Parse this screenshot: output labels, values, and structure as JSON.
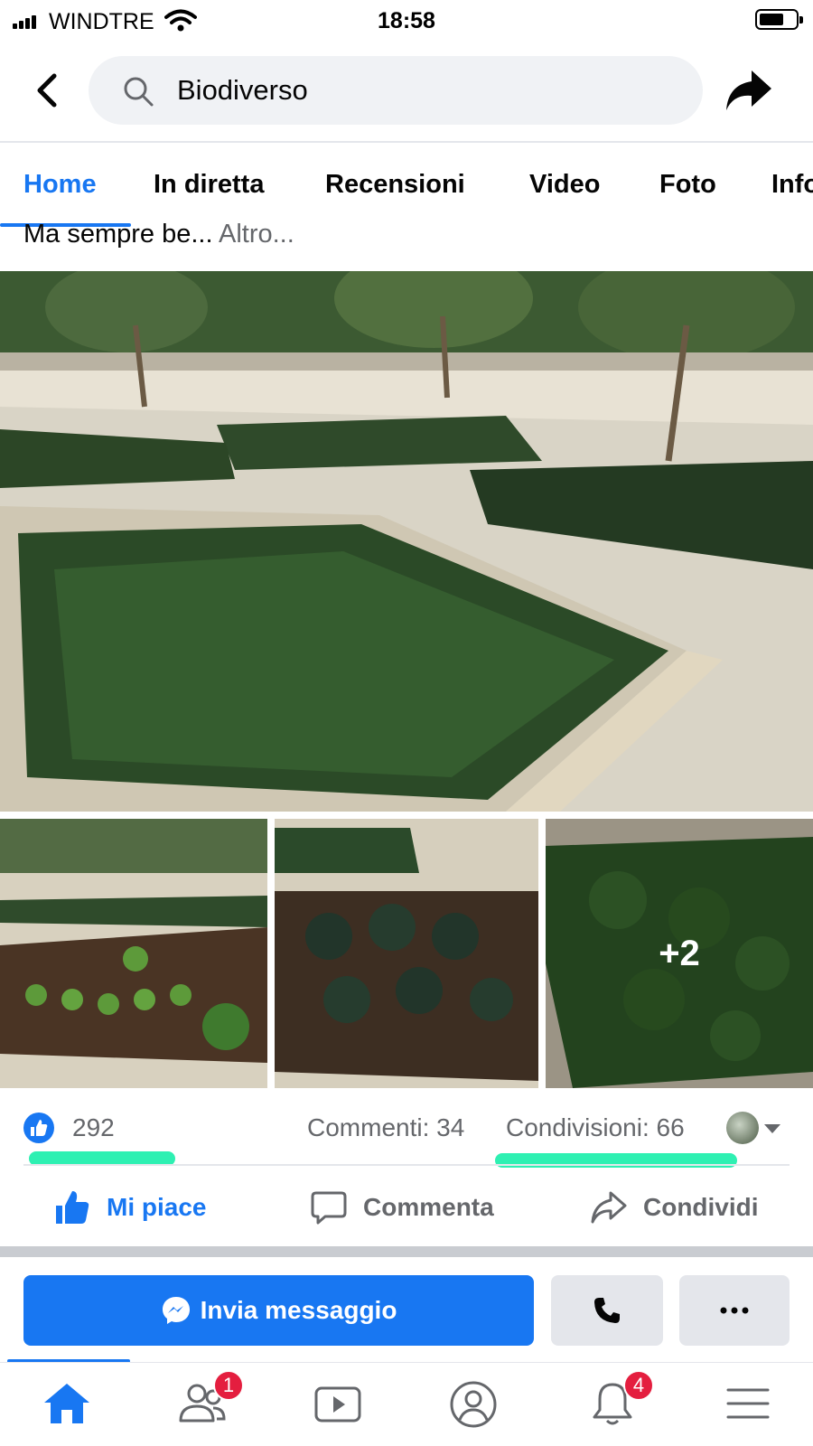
{
  "status_bar": {
    "carrier": "WINDTRE",
    "time": "18:58",
    "battery_level": 0.7
  },
  "header": {
    "search_value": "Biodiverso",
    "back_icon": "chevron-left-icon",
    "share_icon": "share-arrow-icon"
  },
  "tabs": [
    {
      "label": "Home",
      "active": true
    },
    {
      "label": "In diretta",
      "active": false
    },
    {
      "label": "Recensioni",
      "active": false
    },
    {
      "label": "Video",
      "active": false
    },
    {
      "label": "Foto",
      "active": false
    },
    {
      "label": "Info",
      "active": false
    }
  ],
  "post": {
    "text": "Ma sempre be...",
    "more_label": "Altro...",
    "photos": [
      {
        "name": "main-garden-photo"
      },
      {
        "name": "lettuce-bed-photo"
      },
      {
        "name": "kale-bed-photo"
      },
      {
        "name": "chard-bed-photo",
        "overlay": "+2"
      }
    ]
  },
  "reactions": {
    "likes": "292",
    "comments": "Commenti: 34",
    "shares": "Condivisioni: 66"
  },
  "actions": {
    "like": "Mi piace",
    "comment": "Commenta",
    "share": "Condividi"
  },
  "message_bar": {
    "send_message": "Invia messaggio"
  },
  "bottom_nav": {
    "friends_badge": "1",
    "notifications_badge": "4"
  },
  "colors": {
    "accent": "#1877f2",
    "highlight": "#2ef0b2",
    "badge": "#e41e3f"
  }
}
